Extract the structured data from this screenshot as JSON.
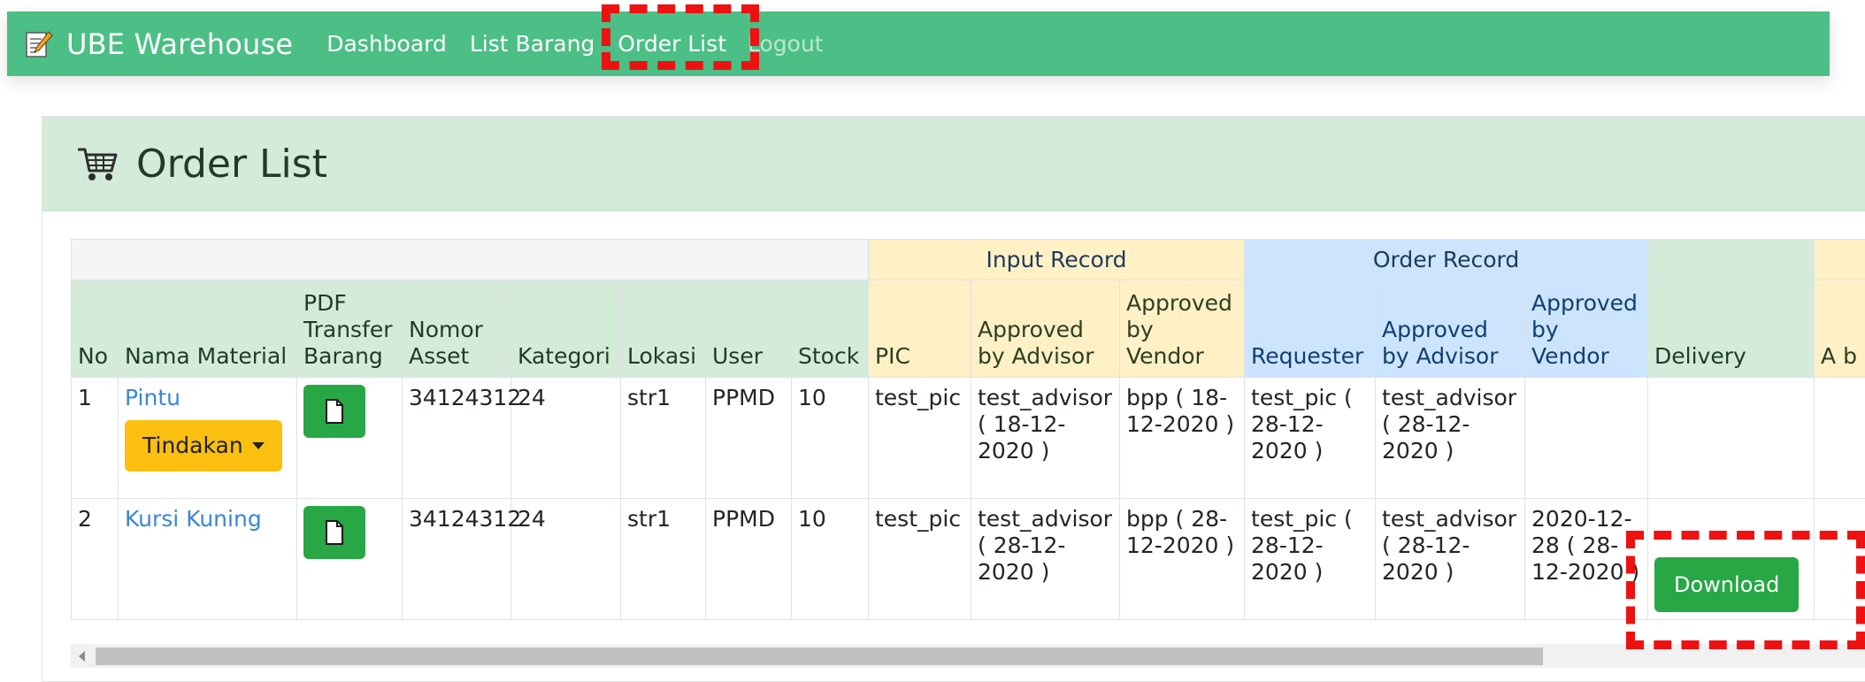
{
  "navbar": {
    "brand": "UBE Warehouse",
    "links": [
      "Dashboard",
      "List Barang",
      "Order List",
      "Logout"
    ]
  },
  "page": {
    "title": "Order List"
  },
  "table": {
    "group_headers": {
      "input_record": "Input Record",
      "order_record": "Order Record"
    },
    "columns": {
      "no": "No",
      "nama_material": "Nama Material",
      "pdf_transfer": "PDF Transfer Barang",
      "nomor_asset": "Nomor Asset",
      "kategori": "Kategori",
      "lokasi": "Lokasi",
      "user": "User",
      "stock": "Stock",
      "pic": "PIC",
      "input_approved_advisor": "Approved by Advisor",
      "input_approved_vendor": "Approved by Vendor",
      "requester": "Requester",
      "order_approved_advisor": "Approved by Advisor",
      "order_approved_vendor": "Approved by Vendor",
      "delivery": "Delivery",
      "next_partial": "A b"
    },
    "action_label": "Tindakan",
    "download_label": "Download",
    "rows": [
      {
        "no": "1",
        "nama_material": "Pintu",
        "nomor_asset": "34124312",
        "kategori": "24",
        "lokasi": "str1",
        "user": "PPMD",
        "stock": "10",
        "pic": "test_pic",
        "input_advisor": "test_advisor ( 18-12-2020 )",
        "input_vendor": "bpp ( 18-12-2020 )",
        "requester": "test_pic ( 28-12-2020 )",
        "order_advisor": "test_advisor ( 28-12-2020 )",
        "order_vendor": "",
        "delivery": ""
      },
      {
        "no": "2",
        "nama_material": "Kursi Kuning",
        "nomor_asset": "34124312",
        "kategori": "24",
        "lokasi": "str1",
        "user": "PPMD",
        "stock": "10",
        "pic": "test_pic",
        "input_advisor": "test_advisor ( 28-12-2020 )",
        "input_vendor": "bpp ( 28-12-2020 )",
        "requester": "test_pic ( 28-12-2020 )",
        "order_advisor": "test_advisor ( 28-12-2020 )",
        "order_vendor": "2020-12-28 ( 28-12-2020 )",
        "delivery": ""
      }
    ]
  },
  "colors": {
    "navbar": "#4bbf85",
    "header_green": "#d5ebda",
    "input_yellow": "#fff0c5",
    "order_blue": "#cce4fd",
    "action_button": "#fbbf10",
    "success_button": "#28a745",
    "highlight": "#ee1111"
  }
}
